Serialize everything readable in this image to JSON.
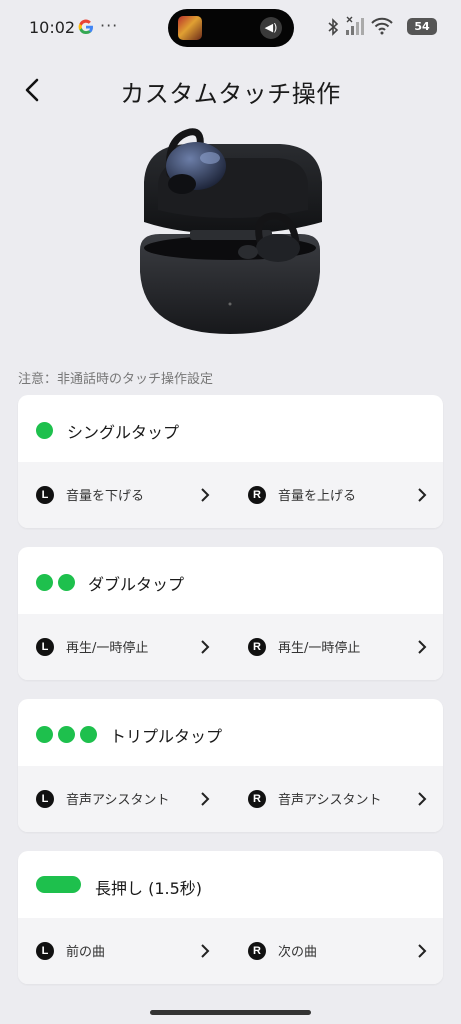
{
  "status_bar": {
    "time": "10:02",
    "more": "···",
    "battery": "54"
  },
  "header": {
    "title": "カスタムタッチ操作"
  },
  "note": "注意：非通話時のタッチ操作設定",
  "gestures": [
    {
      "title": "シングルタップ",
      "indicator": "1 dot",
      "left": {
        "side": "L",
        "label": "音量を下げる"
      },
      "right": {
        "side": "R",
        "label": "音量を上げる"
      }
    },
    {
      "title": "ダブルタップ",
      "indicator": "2 dots",
      "left": {
        "side": "L",
        "label": "再生/一時停止"
      },
      "right": {
        "side": "R",
        "label": "再生/一時停止"
      }
    },
    {
      "title": "トリプルタップ",
      "indicator": "3 dots",
      "left": {
        "side": "L",
        "label": "音声アシスタント"
      },
      "right": {
        "side": "R",
        "label": "音声アシスタント"
      }
    },
    {
      "title": "長押し (1.5秒)",
      "indicator": "pill",
      "left": {
        "side": "L",
        "label": "前の曲"
      },
      "right": {
        "side": "R",
        "label": "次の曲"
      }
    }
  ],
  "colors": {
    "accent": "#1ec04d",
    "background": "#ececf0",
    "card": "#ffffff",
    "action_row": "#f4f4f6"
  }
}
